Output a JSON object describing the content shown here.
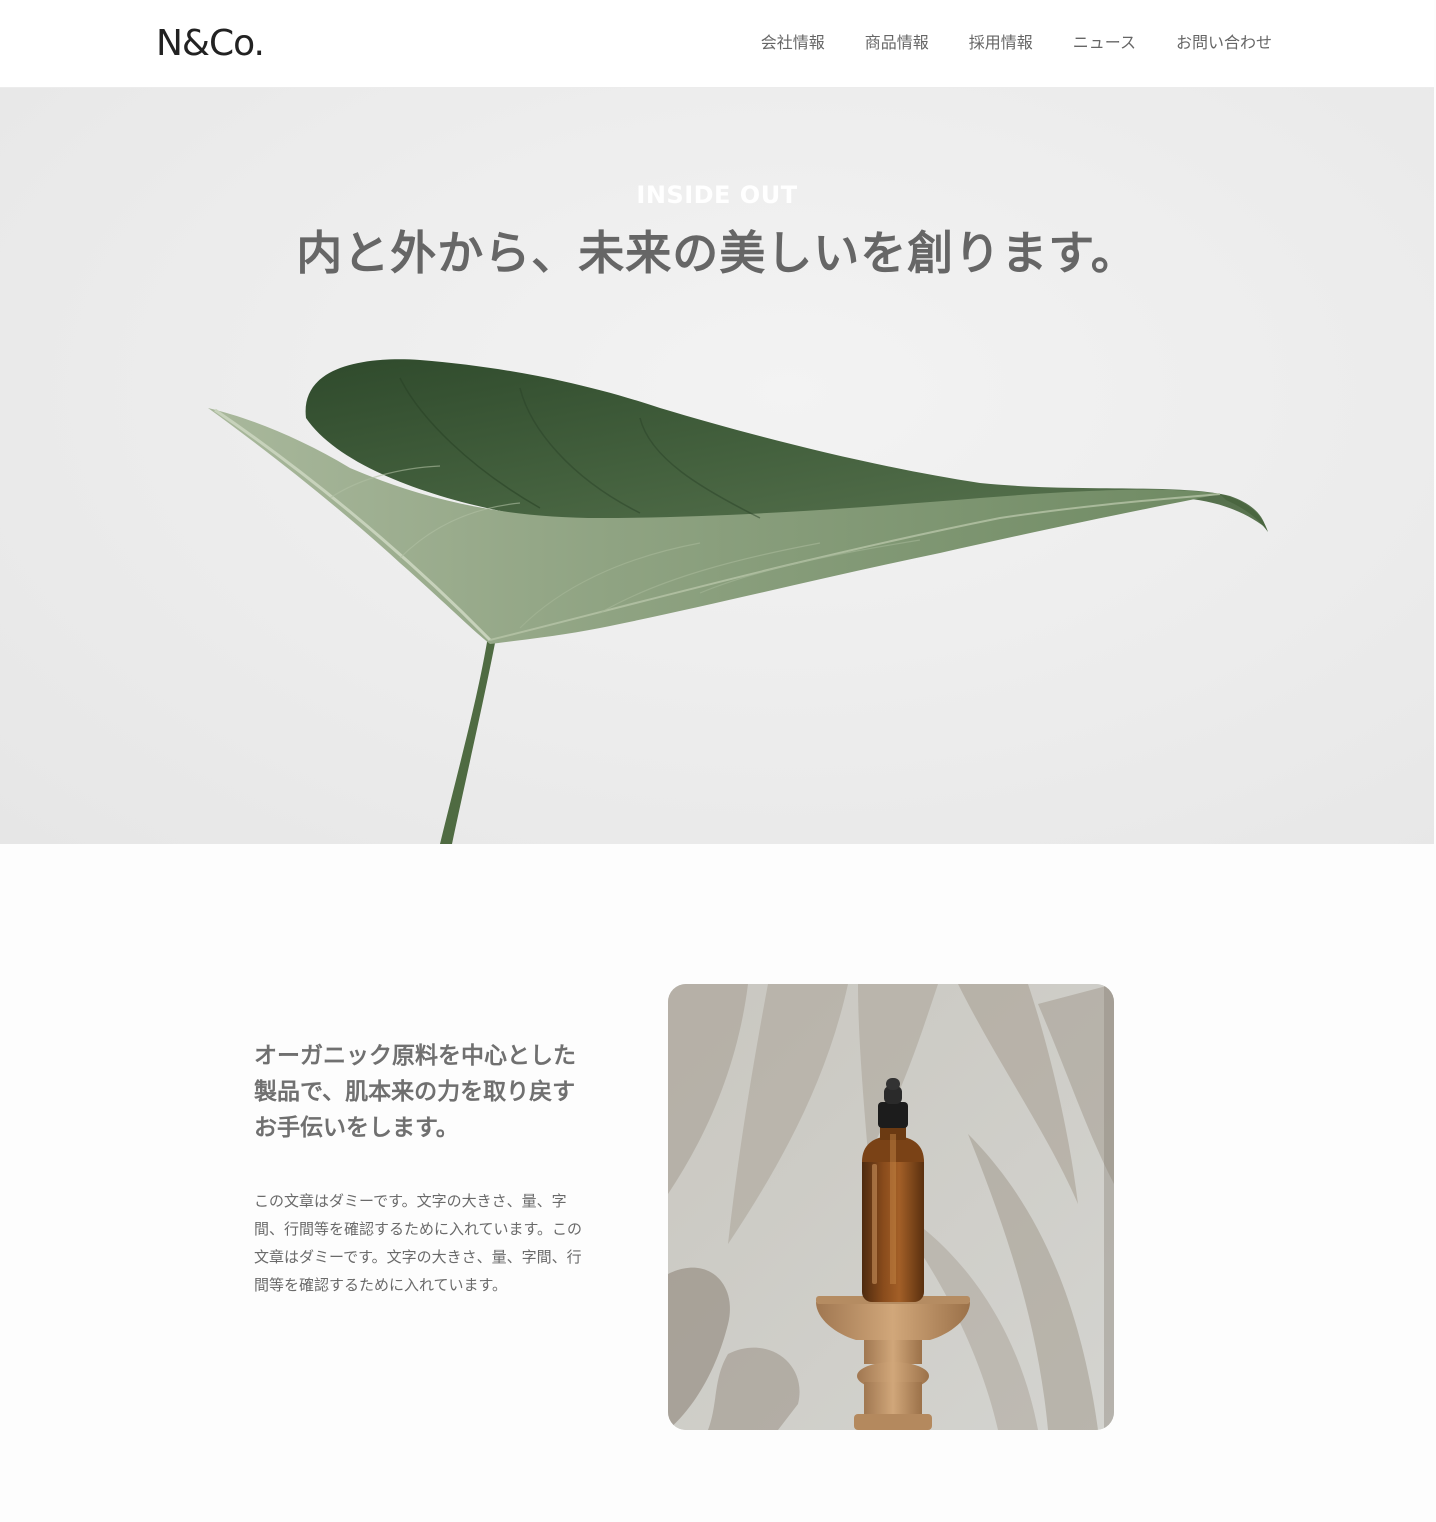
{
  "header": {
    "logo": "N&Co.",
    "nav": [
      "会社情報",
      "商品情報",
      "採用情報",
      "ニュース",
      "お問い合わせ"
    ]
  },
  "hero": {
    "subtitle": "INSIDE OUT",
    "title": "内と外から、未来の美しいを創ります。"
  },
  "intro": {
    "heading_lines": [
      "オーガニック原料を中心とした",
      "製品で、肌本来の力を取り戻す",
      "お手伝いをします。"
    ],
    "body_lines": [
      "この文章はダミーです。文字の大きさ、量、字",
      "間、行間等を確認するために入れています。この",
      "文章はダミーです。文字の大きさ、量、字間、行",
      "間等を確認するために入れています。"
    ]
  },
  "colors": {
    "text": "#666666",
    "logo": "#222222",
    "hero_bg": "#ececec",
    "leaf_dark": "#3f5a3a",
    "leaf_light": "#8fa382",
    "bottle": "#7a4216"
  }
}
